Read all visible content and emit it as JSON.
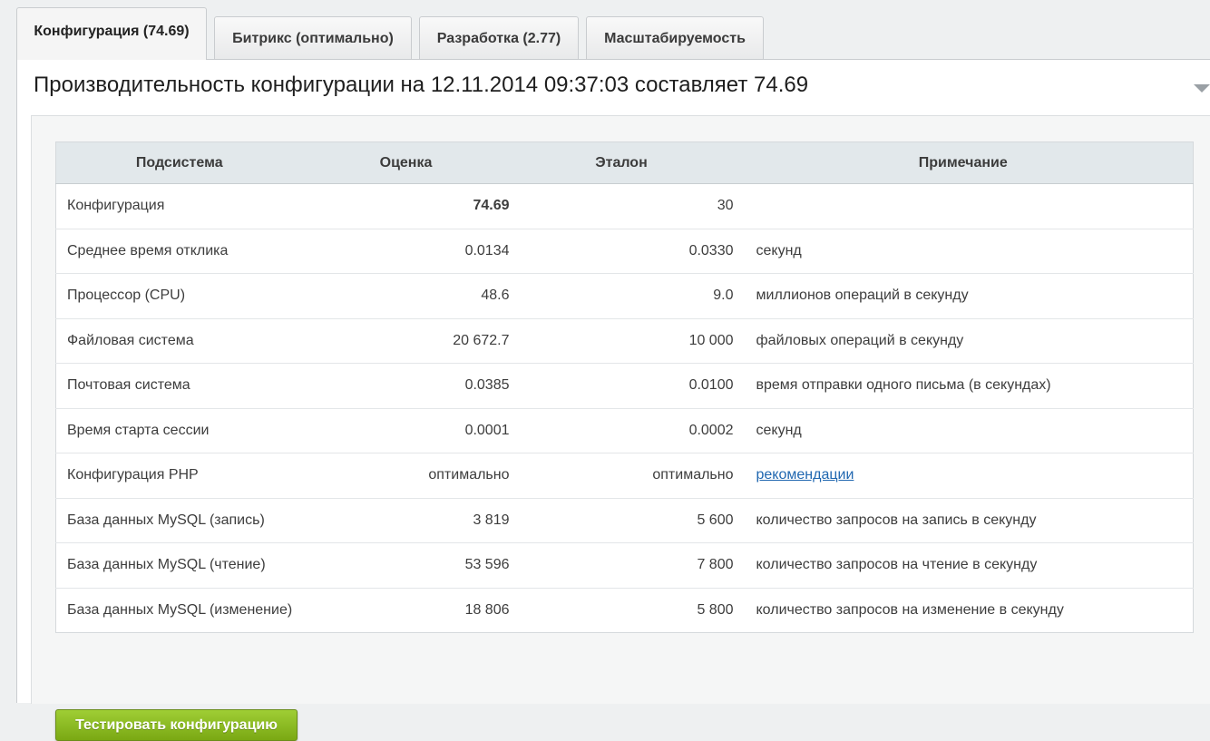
{
  "tabs": [
    {
      "label": "Конфигурация (74.69)",
      "active": true
    },
    {
      "label": "Битрикс (оптимально)",
      "active": false
    },
    {
      "label": "Разработка (2.77)",
      "active": false
    },
    {
      "label": "Масштабируемость",
      "active": false
    }
  ],
  "panel": {
    "title": "Производительность конфигурации на 12.11.2014 09:37:03 составляет 74.69",
    "collapse_icon": "triangle-down-icon"
  },
  "table": {
    "headers": [
      "Подсистема",
      "Оценка",
      "Эталон",
      "Примечание"
    ],
    "rows": [
      {
        "subsystem": "Конфигурация",
        "score": "74.69",
        "reference": "30",
        "note": ""
      },
      {
        "subsystem": "Среднее время отклика",
        "score": "0.0134",
        "reference": "0.0330",
        "note": "секунд"
      },
      {
        "subsystem": "Процессор (CPU)",
        "score": "48.6",
        "reference": "9.0",
        "note": "миллионов операций в секунду"
      },
      {
        "subsystem": "Файловая система",
        "score": "20 672.7",
        "reference": "10 000",
        "note": "файловых операций в секунду"
      },
      {
        "subsystem": "Почтовая система",
        "score": "0.0385",
        "reference": "0.0100",
        "note": "время отправки одного письма (в секундах)"
      },
      {
        "subsystem": "Время старта сессии",
        "score": "0.0001",
        "reference": "0.0002",
        "note": "секунд"
      },
      {
        "subsystem": "Конфигурация PHP",
        "score": "оптимально",
        "reference": "оптимально",
        "note": "рекомендации"
      },
      {
        "subsystem": "База данных MySQL (запись)",
        "score": "3 819",
        "reference": "5 600",
        "note": "количество запросов на запись в секунду"
      },
      {
        "subsystem": "База данных MySQL (чтение)",
        "score": "53 596",
        "reference": "7 800",
        "note": "количество запросов на чтение в секунду"
      },
      {
        "subsystem": "База данных MySQL (изменение)",
        "score": "18 806",
        "reference": "5 800",
        "note": "количество запросов на изменение в секунду"
      }
    ]
  },
  "actions": {
    "test_button": "Тестировать конфигурацию"
  },
  "colors": {
    "button_green": "#8bbb22",
    "link_blue": "#2067b0",
    "header_bg": "#e2e8eb"
  }
}
